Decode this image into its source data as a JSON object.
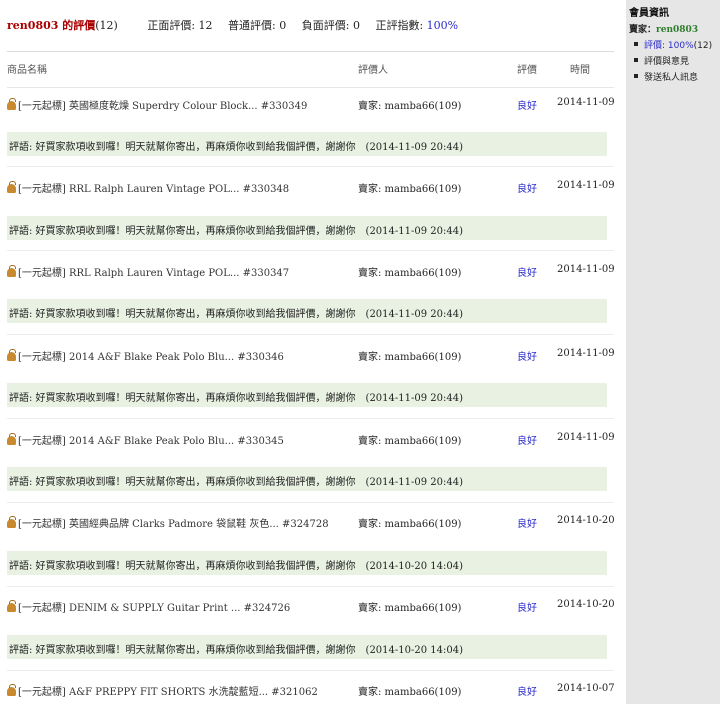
{
  "header": {
    "user": "ren0803 的評價",
    "count": "(12)",
    "positive": "正面評價: 12",
    "neutral": "普通評價: 0",
    "negative": "負面評價: 0",
    "index_label": "正評指數:",
    "index_value": "100%"
  },
  "columns": {
    "product": "商品名稱",
    "rater": "評價人",
    "rating": "評價",
    "date": "時間"
  },
  "reviews": [
    {
      "product": "[一元起標] 英國極度乾燥 Superdry Colour Block... #330349",
      "rater": "賣家: mamba66(109)",
      "rating": "良好",
      "date": "2014-11-09",
      "comment": "評語: 好買家款項收到囉！明天就幫你寄出，再麻煩你收到給我個評價，謝謝你　(2014-11-09 20:44)"
    },
    {
      "product": "[一元起標] RRL Ralph Lauren Vintage POL... #330348",
      "rater": "賣家: mamba66(109)",
      "rating": "良好",
      "date": "2014-11-09",
      "comment": "評語: 好買家款項收到囉！明天就幫你寄出，再麻煩你收到給我個評價，謝謝你　(2014-11-09 20:44)"
    },
    {
      "product": "[一元起標] RRL Ralph Lauren Vintage POL... #330347",
      "rater": "賣家: mamba66(109)",
      "rating": "良好",
      "date": "2014-11-09",
      "comment": "評語: 好買家款項收到囉！明天就幫你寄出，再麻煩你收到給我個評價，謝謝你　(2014-11-09 20:44)"
    },
    {
      "product": "[一元起標] 2014 A&F Blake Peak Polo Blu... #330346",
      "rater": "賣家: mamba66(109)",
      "rating": "良好",
      "date": "2014-11-09",
      "comment": "評語: 好買家款項收到囉！明天就幫你寄出，再麻煩你收到給我個評價，謝謝你　(2014-11-09 20:44)"
    },
    {
      "product": "[一元起標] 2014 A&F Blake Peak Polo Blu... #330345",
      "rater": "賣家: mamba66(109)",
      "rating": "良好",
      "date": "2014-11-09",
      "comment": "評語: 好買家款項收到囉！明天就幫你寄出，再麻煩你收到給我個評價，謝謝你　(2014-11-09 20:44)"
    },
    {
      "product": "[一元起標] 英國經典品牌 Clarks Padmore 袋鼠鞋 灰色... #324728",
      "rater": "賣家: mamba66(109)",
      "rating": "良好",
      "date": "2014-10-20",
      "comment": "評語: 好買家款項收到囉！明天就幫你寄出，再麻煩你收到給我個評價，謝謝你　(2014-10-20 14:04)"
    },
    {
      "product": "[一元起標] DENIM & SUPPLY Guitar Print ... #324726",
      "rater": "賣家: mamba66(109)",
      "rating": "良好",
      "date": "2014-10-20",
      "comment": "評語: 好買家款項收到囉！明天就幫你寄出，再麻煩你收到給我個評價，謝謝你　(2014-10-20 14:04)"
    },
    {
      "product": "[一元起標] A&F PREPPY FIT SHORTS 水洗靛藍短... #321062",
      "rater": "賣家: mamba66(109)",
      "rating": "良好",
      "date": "2014-10-07"
    }
  ],
  "sidebar": {
    "title": "會員資訊",
    "seller_label": "賣家：",
    "seller_name": "ren0803",
    "rating_link": "評價: 100%",
    "rating_count": "(12)",
    "feedback": "評價與意見",
    "message": "發送私人訊息"
  }
}
